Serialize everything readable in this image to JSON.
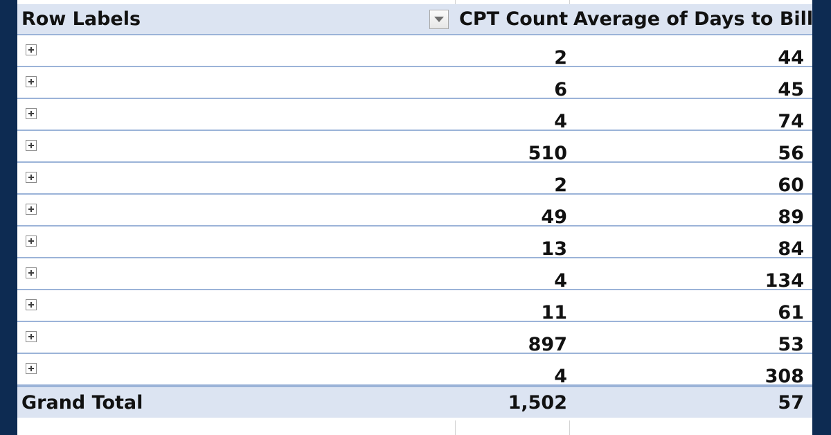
{
  "pivot": {
    "headers": {
      "row_labels": "Row Labels",
      "cpt_count": "CPT Count",
      "avg_days": "Average of Days to Bill"
    },
    "rows": [
      {
        "count": "2",
        "avg": "44"
      },
      {
        "count": "6",
        "avg": "45"
      },
      {
        "count": "4",
        "avg": "74"
      },
      {
        "count": "510",
        "avg": "56"
      },
      {
        "count": "2",
        "avg": "60"
      },
      {
        "count": "49",
        "avg": "89"
      },
      {
        "count": "13",
        "avg": "84"
      },
      {
        "count": "4",
        "avg": "134"
      },
      {
        "count": "11",
        "avg": "61"
      },
      {
        "count": "897",
        "avg": "53"
      },
      {
        "count": "4",
        "avg": "308"
      }
    ],
    "total": {
      "label": "Grand Total",
      "count": "1,502",
      "avg": "57"
    }
  },
  "icons": {
    "filter": "dropdown-filter-icon",
    "expand": "expand-plus-icon"
  },
  "colors": {
    "frame": "#0d2b52",
    "header_bg": "#dce4f2",
    "row_border": "#9bb3d8"
  }
}
